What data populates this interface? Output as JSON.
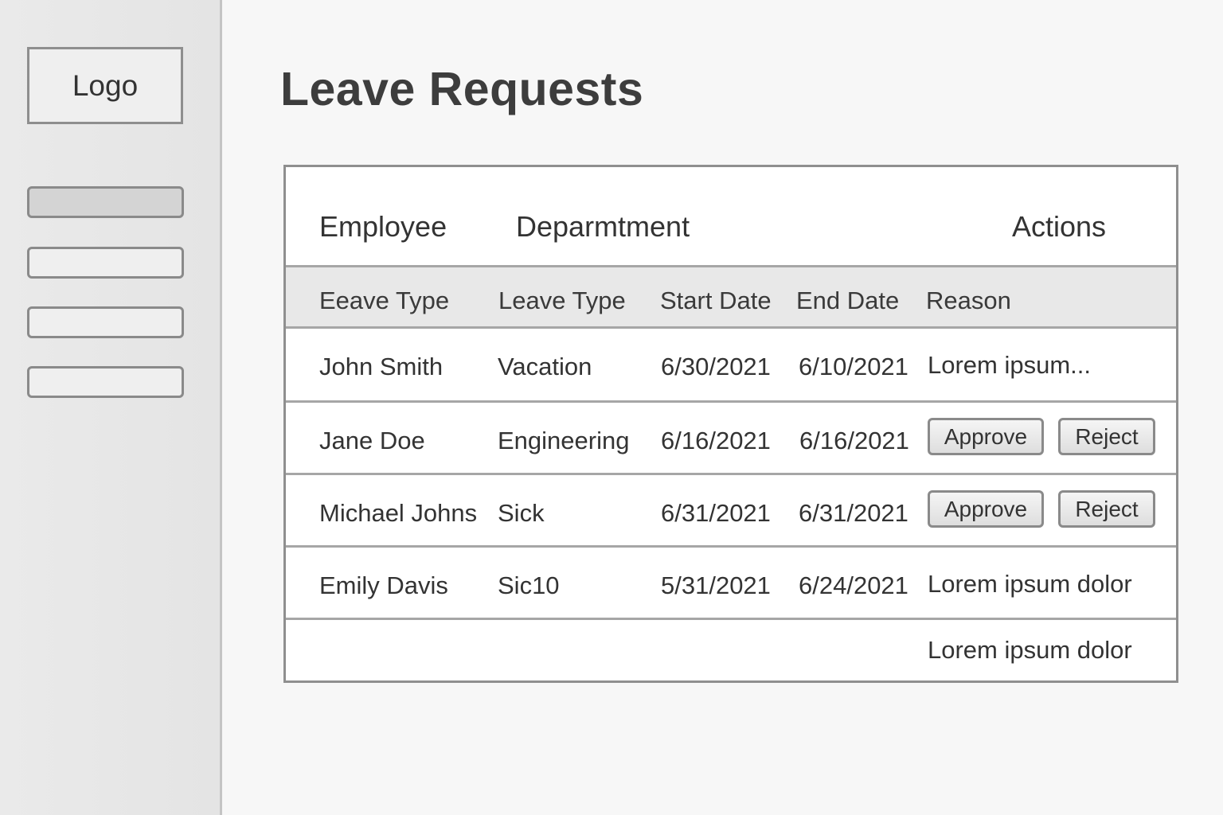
{
  "sidebar": {
    "logo": "Logo"
  },
  "page": {
    "title": "Leave Requests"
  },
  "table": {
    "headers": {
      "employee": "Employee",
      "department": "Deparmtment",
      "actions": "Actions"
    },
    "sub_headers": [
      "Eeave Type",
      "Leave Type",
      "Start Date",
      "End Date",
      "Reason"
    ],
    "rows": [
      {
        "employee": "John Smith",
        "type": "Vacation",
        "start": "6/30/2021",
        "end": "6/10/2021",
        "reason": "Lorem ipsum..."
      },
      {
        "employee": "Jane Doe",
        "type": "Engineering",
        "start": "6/16/2021",
        "end": "6/16/2021",
        "approve": "Approve",
        "reject": "Reject"
      },
      {
        "employee": "Michael Johns",
        "type": "Sick",
        "start": "6/31/2021",
        "end": "6/31/2021",
        "approve": "Approve",
        "reject": "Reject"
      },
      {
        "employee": "Emily Davis",
        "type": "Sic10",
        "start": "5/31/2021",
        "end": "6/24/2021",
        "reason": "Lorem ipsum dolor"
      },
      {
        "reason": "Lorem ipsum dolor"
      }
    ]
  }
}
